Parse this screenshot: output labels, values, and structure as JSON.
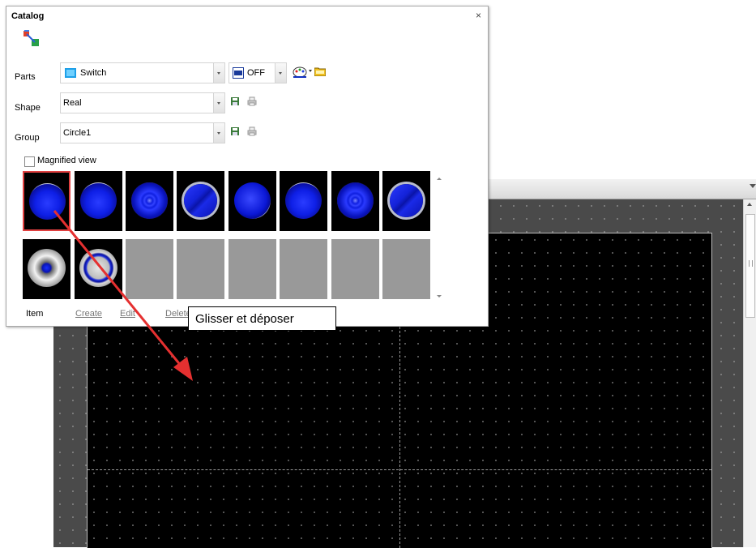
{
  "editor": {},
  "catalog": {
    "title": "Catalog",
    "close_glyph": "×",
    "parts": {
      "label": "Parts",
      "value": "Switch",
      "state": "OFF",
      "state_icon_text": "OFF"
    },
    "shape": {
      "label": "Shape",
      "value": "Real"
    },
    "group": {
      "label": "Group",
      "value": "Circle1"
    },
    "magnified": {
      "label": "Magnified view",
      "checked": false
    },
    "items": [
      "blue-button-1",
      "blue-button-2",
      "blue-button-ringed",
      "blue-button-diagonal",
      "blue-button-3",
      "blue-button-4",
      "blue-button-ringed-2",
      "blue-button-diagonal-2",
      "silver-blue-lamp",
      "silver-ring-button",
      "empty",
      "empty",
      "empty",
      "empty",
      "empty",
      "empty"
    ],
    "selected_index": 0,
    "item_row": {
      "label": "Item",
      "create": "Create",
      "edit": "Edit",
      "delete": "Delete"
    }
  },
  "tooltip": {
    "text": "Glisser et déposer"
  },
  "colors": {
    "accent_selection": "#e04040",
    "arrow": "#e53030",
    "button_blue": "#1020e0"
  }
}
